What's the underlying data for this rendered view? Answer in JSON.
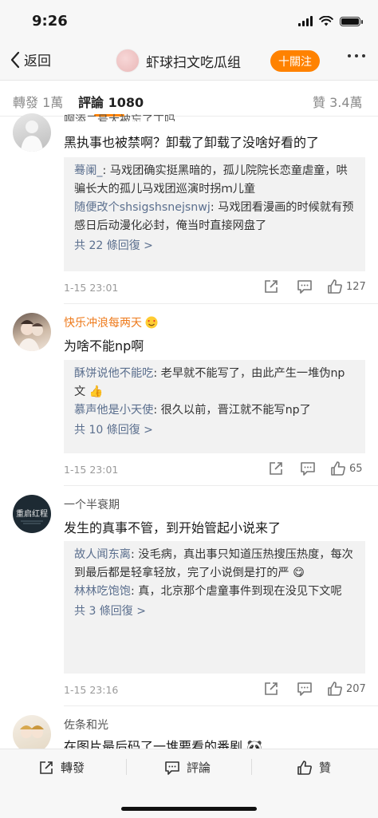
{
  "status": {
    "time": "9:26"
  },
  "nav": {
    "back_label": "返回",
    "title": "虾球扫文吃瓜组",
    "follow_label": "十關注"
  },
  "tabs": {
    "repost": "轉發 1萬",
    "comments": "評論 1080",
    "likes": "贊 3.4萬"
  },
  "comments": [
    {
      "username": "啊添二号大被忘了丁吗",
      "text": "黑执事也被禁啊？卸载了卸载了没啥好看的了",
      "replies": [
        {
          "name": "蓦阑_",
          "text": "马戏团确实挺黑暗的，孤儿院院长恋童虐童，哄骗长大的孤儿马戏团巡演时拐ｍ儿童"
        },
        {
          "name": "随便改个shsigshsnejsnwj",
          "text": "马戏团看漫画的时候就有预感日后动漫化必封，俺当时直接网盘了"
        }
      ],
      "more": "共 22 條回復 >",
      "time": "1-15 23:01",
      "likes": "127"
    },
    {
      "username": "快乐冲浪每两天",
      "username_color": "#ee7a1b",
      "text": "为啥不能np啊",
      "replies": [
        {
          "name": "酥饼说他不能吃",
          "text": "老早就不能写了，由此产生一堆伪np文 👍"
        },
        {
          "name": "慕声他是小天使",
          "text": "很久以前，晋江就不能写np了"
        }
      ],
      "more": "共 10 條回復 >",
      "time": "1-15 23:01",
      "likes": "65"
    },
    {
      "username": "一个半衰期",
      "avatar_text": "重启红程",
      "text": "发生的真事不管，到开始管起小说来了",
      "replies": [
        {
          "name": "故人闻东离",
          "text": "没毛病，真出事只知道压热搜压热度，每次到最后都是轻拿轻放，完了小说倒是打的严 😋"
        },
        {
          "name": "林林吃饱饱",
          "text": "真，北京那个虐童事件到现在没见下文呢"
        }
      ],
      "more": "共 3 條回復 >",
      "time": "1-15 23:16",
      "likes": "207"
    },
    {
      "username": "佐条和光",
      "text": "在图片最后码了一堆要看的番剧 🐼"
    }
  ],
  "bottom": {
    "repost": "轉發",
    "comment": "評論",
    "like": "贊"
  },
  "colors": {
    "accent": "#ff8200",
    "link": "#5b6f8e",
    "reply_bg": "#f2f2f2"
  }
}
